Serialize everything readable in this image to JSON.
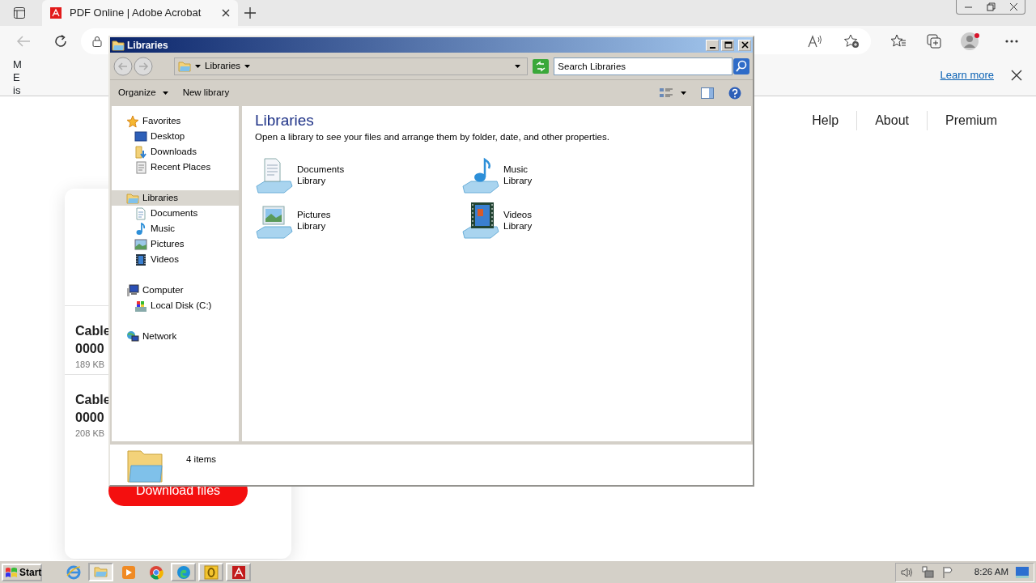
{
  "browser": {
    "tabs": [
      {
        "title": "PDF Online | Adobe Acrobat",
        "selected": true
      }
    ],
    "info_bar": {
      "text_lines": [
        "M",
        "E",
        "is"
      ],
      "link": "Learn more"
    },
    "site_nav": [
      "Help",
      "About",
      "Premium"
    ],
    "files": [
      {
        "name_lines": [
          "Cable",
          "0000"
        ],
        "size": "189 KB"
      },
      {
        "name_lines": [
          "Cable",
          "0000"
        ],
        "size": "208 KB"
      }
    ],
    "download_button": "Download files"
  },
  "explorer": {
    "title": "Libraries",
    "breadcrumb": "Libraries",
    "search": {
      "placeholder": "Search Libraries"
    },
    "toolbar": [
      "Organize",
      "New library"
    ],
    "nav_tree": [
      {
        "label": "Favorites",
        "selected": false,
        "children": [
          {
            "label": "Desktop",
            "selected": false
          },
          {
            "label": "Downloads",
            "selected": false
          },
          {
            "label": "Recent Places",
            "selected": false
          }
        ]
      },
      {
        "label": "Libraries",
        "selected": true,
        "children": [
          {
            "label": "Documents",
            "selected": false
          },
          {
            "label": "Music",
            "selected": false
          },
          {
            "label": "Pictures",
            "selected": false
          },
          {
            "label": "Videos",
            "selected": false
          }
        ]
      },
      {
        "label": "Computer",
        "selected": false,
        "children": [
          {
            "label": "Local Disk (C:)",
            "selected": false
          }
        ]
      },
      {
        "label": "Network",
        "selected": false
      }
    ],
    "heading": "Libraries",
    "description": "Open a library to see your files and arrange them by folder, date, and other properties.",
    "libraries": [
      {
        "name": "Documents",
        "type": "Library"
      },
      {
        "name": "Music",
        "type": "Library"
      },
      {
        "name": "Pictures",
        "type": "Library"
      },
      {
        "name": "Videos",
        "type": "Library"
      }
    ],
    "status": "4 items"
  },
  "taskbar": {
    "start": "Start",
    "apps": [
      {
        "kind": "launcher",
        "selected": false
      },
      {
        "kind": "window",
        "selected": true
      },
      {
        "kind": "launcher",
        "selected": false
      },
      {
        "kind": "launcher",
        "selected": false
      },
      {
        "kind": "window",
        "selected": false
      },
      {
        "kind": "window",
        "selected": false
      },
      {
        "kind": "window",
        "selected": false
      }
    ],
    "clock": "8:26 AM"
  }
}
